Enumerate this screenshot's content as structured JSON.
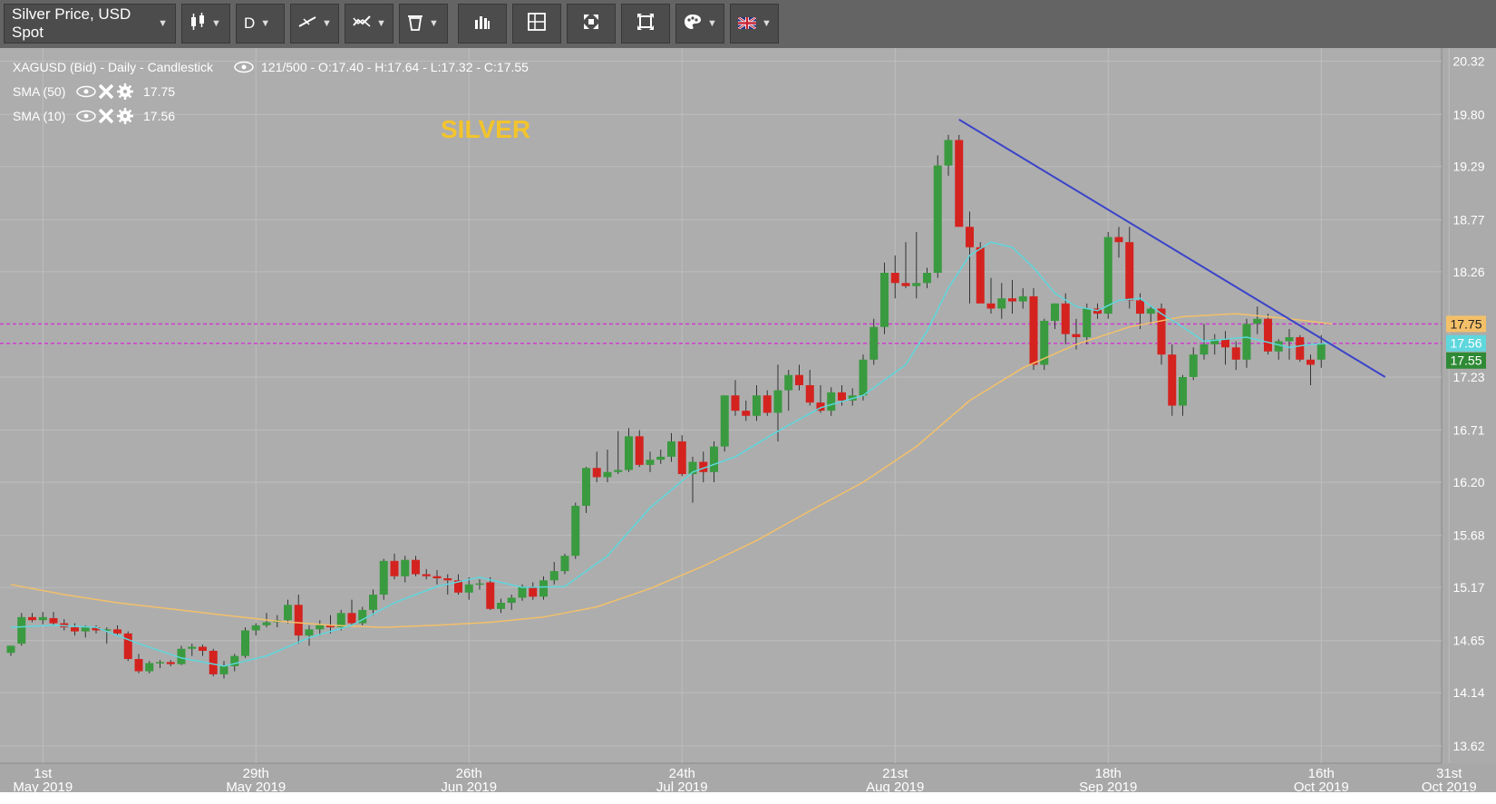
{
  "toolbar": {
    "instrument_label": "Silver Price, USD Spot",
    "chart_type_icon": "candlestick-icon",
    "timeframe_label": "D",
    "draw_icon": "trendline-icon",
    "indicator_icon": "indicator-icon",
    "delete_icon": "trash-icon",
    "bars_icon": "bar-chart-icon",
    "layout_icon": "layout-icon",
    "fullscreen_icon": "fullscreen-icon",
    "fit_icon": "fit-icon",
    "theme_icon": "palette-icon",
    "language_icon": "uk-flag-icon"
  },
  "legend": {
    "main": "XAGUSD (Bid) - Daily - Candlestick",
    "main_values": "121/500 - O:17.40 - H:17.64 - L:17.32 - C:17.55",
    "sma50_label": "SMA (50)",
    "sma50_value": "17.75",
    "sma10_label": "SMA (10)",
    "sma10_value": "17.56"
  },
  "watermark": "SILVER",
  "colors": {
    "background": "#adadad",
    "up": "#3a9a3f",
    "down": "#d4231f",
    "sma50": "#f3c069",
    "sma10": "#5ed7dd",
    "trendline": "#3b44c8",
    "hline": "#d13bd1",
    "watermark": "#f3c42c"
  },
  "price_labels": {
    "sma50": "17.75",
    "sma10": "17.56",
    "close": "17.55"
  },
  "chart_data": {
    "type": "candlestick",
    "title": "",
    "ylim": [
      13.45,
      20.45
    ],
    "y_ticks": [
      "20.32",
      "19.80",
      "19.29",
      "18.77",
      "18.26",
      "17.23",
      "16.71",
      "16.20",
      "15.68",
      "15.17",
      "14.65",
      "14.14",
      "13.62"
    ],
    "x_ticks": [
      {
        "day": "1st",
        "month": "May 2019",
        "i": 3
      },
      {
        "day": "29th",
        "month": "May 2019",
        "i": 23
      },
      {
        "day": "26th",
        "month": "Jun 2019",
        "i": 43
      },
      {
        "day": "24th",
        "month": "Jul 2019",
        "i": 63
      },
      {
        "day": "21st",
        "month": "Aug 2019",
        "i": 83
      },
      {
        "day": "18th",
        "month": "Sep 2019",
        "i": 103
      },
      {
        "day": "16th",
        "month": "Oct 2019",
        "i": 123
      },
      {
        "day": "31st",
        "month": "Oct 2019",
        "i": 135
      }
    ],
    "candles": [
      [
        14.53,
        14.6,
        14.5,
        14.6
      ],
      [
        14.62,
        14.92,
        14.6,
        14.88
      ],
      [
        14.88,
        14.92,
        14.83,
        14.85
      ],
      [
        14.85,
        14.93,
        14.81,
        14.88
      ],
      [
        14.87,
        14.93,
        14.8,
        14.82
      ],
      [
        14.82,
        14.86,
        14.75,
        14.78
      ],
      [
        14.78,
        14.82,
        14.7,
        14.74
      ],
      [
        14.74,
        14.8,
        14.68,
        14.78
      ],
      [
        14.78,
        14.8,
        14.72,
        14.75
      ],
      [
        14.75,
        14.78,
        14.62,
        14.76
      ],
      [
        14.76,
        14.8,
        14.7,
        14.72
      ],
      [
        14.72,
        14.74,
        14.45,
        14.47
      ],
      [
        14.47,
        14.52,
        14.33,
        14.35
      ],
      [
        14.35,
        14.45,
        14.33,
        14.43
      ],
      [
        14.43,
        14.46,
        14.38,
        14.44
      ],
      [
        14.44,
        14.46,
        14.4,
        14.42
      ],
      [
        14.42,
        14.6,
        14.41,
        14.57
      ],
      [
        14.57,
        14.62,
        14.5,
        14.59
      ],
      [
        14.59,
        14.61,
        14.5,
        14.55
      ],
      [
        14.55,
        14.57,
        14.3,
        14.32
      ],
      [
        14.32,
        14.45,
        14.28,
        14.4
      ],
      [
        14.4,
        14.52,
        14.35,
        14.5
      ],
      [
        14.5,
        14.78,
        14.48,
        14.75
      ],
      [
        14.75,
        14.82,
        14.7,
        14.8
      ],
      [
        14.8,
        14.92,
        14.78,
        14.83
      ],
      [
        14.83,
        14.9,
        14.78,
        14.85
      ],
      [
        14.85,
        15.05,
        14.82,
        15.0
      ],
      [
        15.0,
        15.1,
        14.62,
        14.7
      ],
      [
        14.7,
        14.8,
        14.6,
        14.76
      ],
      [
        14.76,
        14.85,
        14.7,
        14.8
      ],
      [
        14.8,
        14.9,
        14.72,
        14.78
      ],
      [
        14.78,
        14.95,
        14.75,
        14.92
      ],
      [
        14.92,
        15.05,
        14.8,
        14.82
      ],
      [
        14.82,
        14.98,
        14.8,
        14.95
      ],
      [
        14.95,
        15.15,
        14.9,
        15.1
      ],
      [
        15.1,
        15.45,
        15.05,
        15.43
      ],
      [
        15.43,
        15.5,
        15.25,
        15.28
      ],
      [
        15.28,
        15.48,
        15.22,
        15.44
      ],
      [
        15.44,
        15.48,
        15.28,
        15.3
      ],
      [
        15.3,
        15.35,
        15.25,
        15.28
      ],
      [
        15.28,
        15.34,
        15.2,
        15.26
      ],
      [
        15.26,
        15.3,
        15.1,
        15.24
      ],
      [
        15.24,
        15.3,
        15.1,
        15.12
      ],
      [
        15.12,
        15.27,
        15.05,
        15.2
      ],
      [
        15.2,
        15.25,
        15.15,
        15.21
      ],
      [
        15.22,
        15.27,
        14.95,
        14.96
      ],
      [
        14.96,
        15.06,
        14.92,
        15.02
      ],
      [
        15.02,
        15.1,
        14.95,
        15.07
      ],
      [
        15.07,
        15.2,
        15.04,
        15.18
      ],
      [
        15.18,
        15.22,
        15.05,
        15.08
      ],
      [
        15.08,
        15.28,
        15.05,
        15.24
      ],
      [
        15.24,
        15.42,
        15.2,
        15.33
      ],
      [
        15.33,
        15.5,
        15.3,
        15.48
      ],
      [
        15.48,
        16.0,
        15.45,
        15.97
      ],
      [
        15.97,
        16.35,
        15.9,
        16.34
      ],
      [
        16.34,
        16.5,
        16.2,
        16.25
      ],
      [
        16.25,
        16.52,
        16.2,
        16.3
      ],
      [
        16.3,
        16.7,
        16.28,
        16.32
      ],
      [
        16.32,
        16.73,
        16.3,
        16.65
      ],
      [
        16.65,
        16.71,
        16.35,
        16.37
      ],
      [
        16.37,
        16.5,
        16.3,
        16.42
      ],
      [
        16.42,
        16.52,
        16.38,
        16.45
      ],
      [
        16.45,
        16.68,
        16.4,
        16.6
      ],
      [
        16.6,
        16.66,
        16.26,
        16.28
      ],
      [
        16.28,
        16.45,
        16.0,
        16.4
      ],
      [
        16.4,
        16.5,
        16.2,
        16.3
      ],
      [
        16.3,
        16.6,
        16.2,
        16.55
      ],
      [
        16.55,
        17.05,
        16.5,
        17.05
      ],
      [
        17.05,
        17.2,
        16.85,
        16.9
      ],
      [
        16.9,
        17.0,
        16.8,
        16.85
      ],
      [
        16.85,
        17.15,
        16.8,
        17.05
      ],
      [
        17.05,
        17.1,
        16.85,
        16.88
      ],
      [
        16.88,
        17.35,
        16.6,
        17.1
      ],
      [
        17.1,
        17.3,
        16.9,
        17.25
      ],
      [
        17.25,
        17.35,
        17.1,
        17.15
      ],
      [
        17.15,
        17.3,
        16.95,
        16.98
      ],
      [
        16.98,
        17.15,
        16.88,
        16.9
      ],
      [
        16.9,
        17.13,
        16.85,
        17.08
      ],
      [
        17.08,
        17.15,
        16.95,
        17.0
      ],
      [
        17.0,
        17.12,
        16.95,
        17.05
      ],
      [
        17.05,
        17.45,
        17.0,
        17.4
      ],
      [
        17.4,
        17.8,
        17.35,
        17.72
      ],
      [
        17.72,
        18.35,
        17.65,
        18.25
      ],
      [
        18.25,
        18.42,
        18.0,
        18.15
      ],
      [
        18.15,
        18.55,
        18.1,
        18.12
      ],
      [
        18.12,
        18.65,
        18.0,
        18.15
      ],
      [
        18.15,
        18.3,
        18.1,
        18.25
      ],
      [
        18.25,
        19.4,
        18.2,
        19.3
      ],
      [
        19.3,
        19.6,
        19.2,
        19.55
      ],
      [
        19.55,
        19.6,
        18.95,
        18.7
      ],
      [
        18.7,
        18.85,
        17.95,
        18.5
      ],
      [
        18.5,
        18.55,
        18.0,
        17.95
      ],
      [
        17.95,
        18.2,
        17.85,
        17.9
      ],
      [
        17.9,
        18.15,
        17.8,
        18.0
      ],
      [
        18.0,
        18.18,
        17.85,
        17.97
      ],
      [
        17.97,
        18.1,
        17.9,
        18.02
      ],
      [
        18.02,
        18.1,
        17.3,
        17.35
      ],
      [
        17.35,
        17.8,
        17.3,
        17.78
      ],
      [
        17.78,
        17.95,
        17.7,
        17.95
      ],
      [
        17.95,
        18.05,
        17.55,
        17.65
      ],
      [
        17.65,
        17.8,
        17.5,
        17.62
      ],
      [
        17.62,
        17.95,
        17.55,
        17.9
      ],
      [
        17.9,
        17.95,
        17.8,
        17.85
      ],
      [
        17.85,
        18.65,
        17.8,
        18.6
      ],
      [
        18.6,
        18.7,
        18.4,
        18.55
      ],
      [
        18.55,
        18.7,
        17.9,
        17.98
      ],
      [
        17.98,
        18.05,
        17.7,
        17.85
      ],
      [
        17.85,
        17.92,
        17.75,
        17.9
      ],
      [
        17.9,
        17.95,
        17.35,
        17.45
      ],
      [
        17.45,
        17.55,
        16.85,
        16.95
      ],
      [
        16.95,
        17.25,
        16.85,
        17.23
      ],
      [
        17.23,
        17.52,
        17.2,
        17.45
      ],
      [
        17.45,
        17.75,
        17.4,
        17.55
      ],
      [
        17.55,
        17.65,
        17.45,
        17.6
      ],
      [
        17.6,
        17.68,
        17.35,
        17.52
      ],
      [
        17.52,
        17.58,
        17.3,
        17.4
      ],
      [
        17.4,
        17.8,
        17.32,
        17.75
      ],
      [
        17.75,
        17.92,
        17.65,
        17.8
      ],
      [
        17.8,
        17.85,
        17.45,
        17.48
      ],
      [
        17.48,
        17.6,
        17.4,
        17.58
      ],
      [
        17.58,
        17.7,
        17.4,
        17.62
      ],
      [
        17.62,
        17.64,
        17.38,
        17.4
      ],
      [
        17.4,
        17.45,
        17.15,
        17.35
      ],
      [
        17.4,
        17.64,
        17.32,
        17.55
      ]
    ],
    "series": [
      {
        "name": "SMA (50)",
        "points": [
          [
            0,
            15.2
          ],
          [
            5,
            15.1
          ],
          [
            10,
            15.02
          ],
          [
            15,
            14.96
          ],
          [
            20,
            14.9
          ],
          [
            25,
            14.84
          ],
          [
            30,
            14.8
          ],
          [
            35,
            14.78
          ],
          [
            40,
            14.8
          ],
          [
            45,
            14.83
          ],
          [
            50,
            14.88
          ],
          [
            55,
            14.98
          ],
          [
            60,
            15.16
          ],
          [
            65,
            15.38
          ],
          [
            70,
            15.63
          ],
          [
            75,
            15.92
          ],
          [
            80,
            16.2
          ],
          [
            85,
            16.55
          ],
          [
            90,
            17.0
          ],
          [
            95,
            17.32
          ],
          [
            100,
            17.55
          ],
          [
            105,
            17.72
          ],
          [
            110,
            17.82
          ],
          [
            115,
            17.85
          ],
          [
            120,
            17.8
          ],
          [
            124,
            17.75
          ]
        ]
      },
      {
        "name": "SMA (10)",
        "points": [
          [
            0,
            14.78
          ],
          [
            4,
            14.8
          ],
          [
            8,
            14.78
          ],
          [
            12,
            14.62
          ],
          [
            16,
            14.48
          ],
          [
            20,
            14.4
          ],
          [
            24,
            14.5
          ],
          [
            28,
            14.68
          ],
          [
            32,
            14.8
          ],
          [
            36,
            15.02
          ],
          [
            40,
            15.18
          ],
          [
            44,
            15.27
          ],
          [
            48,
            15.17
          ],
          [
            52,
            15.18
          ],
          [
            56,
            15.48
          ],
          [
            60,
            15.95
          ],
          [
            64,
            16.3
          ],
          [
            68,
            16.45
          ],
          [
            72,
            16.7
          ],
          [
            76,
            16.93
          ],
          [
            80,
            17.05
          ],
          [
            84,
            17.35
          ],
          [
            86,
            17.68
          ],
          [
            88,
            18.1
          ],
          [
            90,
            18.42
          ],
          [
            92,
            18.55
          ],
          [
            94,
            18.5
          ],
          [
            96,
            18.3
          ],
          [
            98,
            18.05
          ],
          [
            100,
            17.92
          ],
          [
            102,
            17.88
          ],
          [
            104,
            17.98
          ],
          [
            106,
            18.0
          ],
          [
            108,
            17.85
          ],
          [
            110,
            17.72
          ],
          [
            112,
            17.58
          ],
          [
            114,
            17.6
          ],
          [
            116,
            17.62
          ],
          [
            118,
            17.57
          ],
          [
            120,
            17.52
          ],
          [
            122,
            17.55
          ],
          [
            124,
            17.56
          ]
        ]
      }
    ],
    "trendline": [
      [
        89,
        19.75
      ],
      [
        129,
        17.23
      ]
    ],
    "hlines": [
      17.75,
      17.56
    ]
  }
}
